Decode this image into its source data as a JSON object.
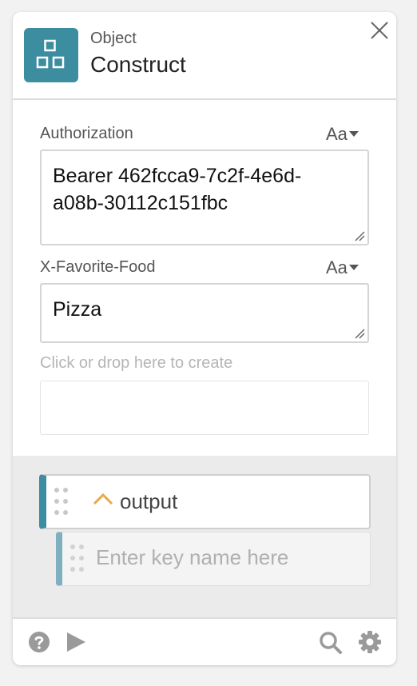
{
  "header": {
    "subtitle": "Object",
    "title": "Construct",
    "icon": "object-construct-icon",
    "accent_color": "#3d8da0"
  },
  "fields": [
    {
      "label": "Authorization",
      "type_toggle": "Aa",
      "value_line1": "Bearer 462fcca9-7c2f-4e6d-",
      "value_line2": "a08b-30112c151fbc"
    },
    {
      "label": "X-Favorite-Food",
      "type_toggle": "Aa",
      "value_line1": "Pizza"
    }
  ],
  "create_hint": "Click or drop here to create",
  "output": {
    "label": "output",
    "key_placeholder": "Enter key name here",
    "chevron_color": "#e8a84a"
  },
  "footer": {
    "icons": [
      "help-icon",
      "play-icon",
      "search-icon",
      "gear-icon"
    ]
  }
}
